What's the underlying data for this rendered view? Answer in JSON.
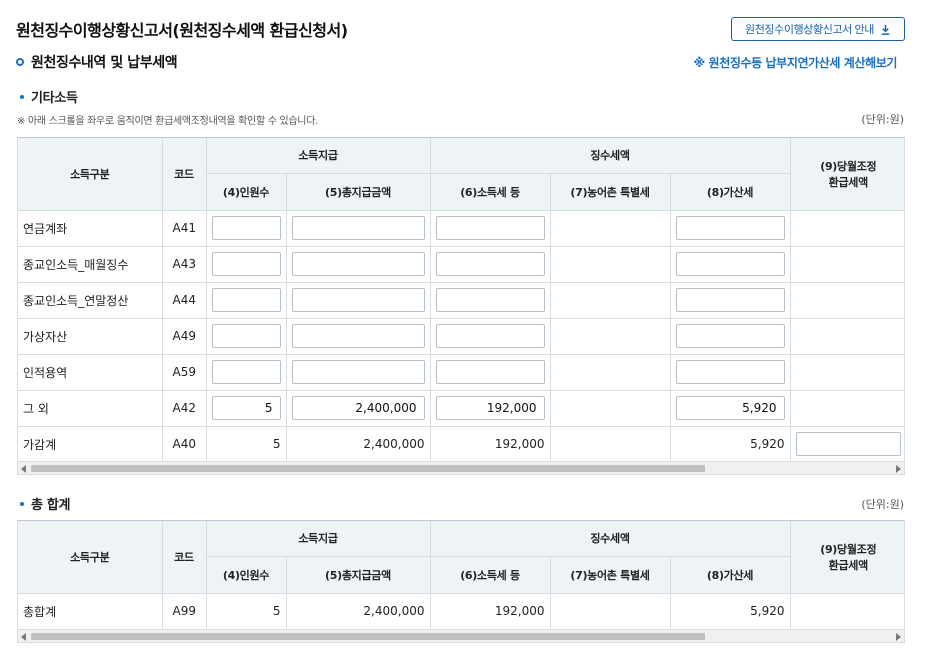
{
  "page_title": "원천징수이행상황신고서(원천징수세액 환급신청서)",
  "guide_button": "원천징수이행상황신고서 안내",
  "section_title": "원천징수내역 및 납부세액",
  "calc_link": "※ 원천징수등 납부지연가산세 계산해보기",
  "other_income": {
    "title": "기타소득",
    "note": "※ 아래 스크롤을 좌우로 움직이면 환급세액조정내역을 확인할 수 있습니다.",
    "unit": "(단위:원)"
  },
  "headers": {
    "income_type": "소득구분",
    "code": "코드",
    "payment_group": "소득지급",
    "tax_group": "징수세액",
    "refund_line1": "(9)당월조정",
    "refund_line2": "환급세액",
    "persons": "(4)인원수",
    "total_paid": "(5)총지급금액",
    "income_tax": "(6)소득세 등",
    "rural_tax": "(7)농어촌 특별세",
    "additional_tax": "(8)가산세"
  },
  "rows": [
    {
      "name": "연금계좌",
      "code": "A41",
      "persons": "",
      "total_paid": "",
      "income_tax": "",
      "additional_tax": ""
    },
    {
      "name": "종교인소득_매월징수",
      "code": "A43",
      "persons": "",
      "total_paid": "",
      "income_tax": "",
      "additional_tax": ""
    },
    {
      "name": "종교인소득_연말정산",
      "code": "A44",
      "persons": "",
      "total_paid": "",
      "income_tax": "",
      "additional_tax": ""
    },
    {
      "name": "가상자산",
      "code": "A49",
      "persons": "",
      "total_paid": "",
      "income_tax": "",
      "additional_tax": ""
    },
    {
      "name": "인적용역",
      "code": "A59",
      "persons": "",
      "total_paid": "",
      "income_tax": "",
      "additional_tax": ""
    },
    {
      "name": "그 외",
      "code": "A42",
      "persons": "5",
      "total_paid": "2,400,000",
      "income_tax": "192,000",
      "additional_tax": "5,920"
    }
  ],
  "subtotal": {
    "name": "가감계",
    "code": "A40",
    "persons": "5",
    "total_paid": "2,400,000",
    "income_tax": "192,000",
    "additional_tax": "5,920",
    "refund": ""
  },
  "grand_total_section": {
    "title": "총 합계",
    "unit": "(단위:원)",
    "row": {
      "name": "총합계",
      "code": "A99",
      "persons": "5",
      "total_paid": "2,400,000",
      "income_tax": "192,000",
      "additional_tax": "5,920"
    }
  },
  "colors": {
    "accent": "#1b6fc1",
    "header_bg": "#eef4f6",
    "border": "#d5dde3"
  },
  "icons": {
    "download": "download-icon",
    "section": "ring-icon",
    "bullet": "dot-icon"
  }
}
